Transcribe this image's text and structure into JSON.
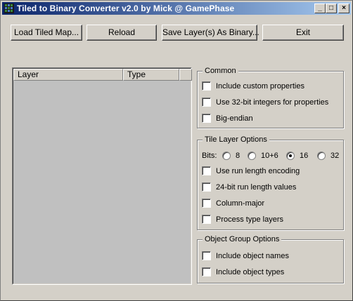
{
  "window": {
    "title": "Tiled to Binary Converter v2.0 by Mick @ GamePhase",
    "controls": {
      "minimize": "_",
      "maximize": "□",
      "close": "×"
    }
  },
  "toolbar": {
    "load": "Load Tiled Map...",
    "reload": "Reload",
    "save": "Save Layer(s) As Binary...",
    "exit": "Exit"
  },
  "layer_list": {
    "columns": [
      "Layer",
      "Type"
    ],
    "rows": []
  },
  "common": {
    "title": "Common",
    "options": [
      {
        "label": "Include custom properties",
        "checked": false
      },
      {
        "label": "Use 32-bit integers for properties",
        "checked": false
      },
      {
        "label": "Big-endian",
        "checked": false
      }
    ]
  },
  "tile_layer": {
    "title": "Tile Layer Options",
    "bits_label": "Bits:",
    "bits": [
      {
        "label": "8",
        "selected": false
      },
      {
        "label": "10+6",
        "selected": false
      },
      {
        "label": "16",
        "selected": true
      },
      {
        "label": "32",
        "selected": false
      }
    ],
    "options": [
      {
        "label": "Use run length encoding",
        "checked": false
      },
      {
        "label": "24-bit run length values",
        "checked": false
      },
      {
        "label": "Column-major",
        "checked": false
      },
      {
        "label": "Process type layers",
        "checked": false
      }
    ]
  },
  "object_group": {
    "title": "Object Group Options",
    "options": [
      {
        "label": "Include object names",
        "checked": false
      },
      {
        "label": "Include object types",
        "checked": false
      }
    ]
  },
  "colors": {
    "face": "#d4d0c8",
    "title_start": "#0a246a",
    "title_end": "#a6caf0",
    "list_bg": "#c0c0c0"
  }
}
